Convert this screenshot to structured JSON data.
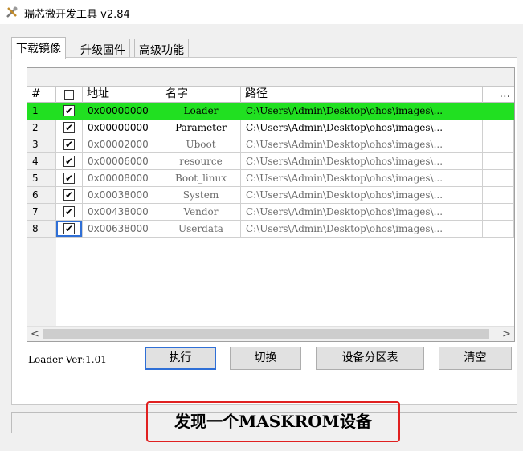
{
  "window": {
    "title": "瑞芯微开发工具 v2.84",
    "icon": "rockchip-tool-icon"
  },
  "tabs": [
    {
      "label": "下载镜像",
      "active": true
    },
    {
      "label": "升级固件",
      "active": false
    },
    {
      "label": "高级功能",
      "active": false
    }
  ],
  "table": {
    "columns": [
      "#",
      "",
      "地址",
      "名字",
      "路径",
      "..."
    ],
    "rows": [
      {
        "num": "1",
        "checked": "✔",
        "address": "0x00000000",
        "name": "Loader",
        "path": "C:\\Users\\Admin\\Desktop\\ohos\\images\\...",
        "selected": true
      },
      {
        "num": "2",
        "checked": "✔",
        "address": "0x00000000",
        "name": "Parameter",
        "path": "C:\\Users\\Admin\\Desktop\\ohos\\images\\...",
        "selected": false
      },
      {
        "num": "3",
        "checked": "✔",
        "address": "0x00002000",
        "name": "Uboot",
        "path": "C:\\Users\\Admin\\Desktop\\ohos\\images\\...",
        "selected": false
      },
      {
        "num": "4",
        "checked": "✔",
        "address": "0x00006000",
        "name": "resource",
        "path": "C:\\Users\\Admin\\Desktop\\ohos\\images\\...",
        "selected": false
      },
      {
        "num": "5",
        "checked": "✔",
        "address": "0x00008000",
        "name": "Boot_linux",
        "path": "C:\\Users\\Admin\\Desktop\\ohos\\images\\...",
        "selected": false
      },
      {
        "num": "6",
        "checked": "✔",
        "address": "0x00038000",
        "name": "System",
        "path": "C:\\Users\\Admin\\Desktop\\ohos\\images\\...",
        "selected": false
      },
      {
        "num": "7",
        "checked": "✔",
        "address": "0x00438000",
        "name": "Vendor",
        "path": "C:\\Users\\Admin\\Desktop\\ohos\\images\\...",
        "selected": false
      },
      {
        "num": "8",
        "checked": "✔",
        "address": "0x00638000",
        "name": "Userdata",
        "path": "C:\\Users\\Admin\\Desktop\\ohos\\images\\...",
        "selected": false
      }
    ],
    "scroll_left": "<",
    "scroll_right": ">"
  },
  "loader_version": "Loader Ver:1.01",
  "buttons": {
    "execute": "执行",
    "switch": "切换",
    "partition_table": "设备分区表",
    "clear": "清空"
  },
  "status": {
    "message": "发现一个MASKROM设备"
  },
  "colors": {
    "selected_row": "#21e021",
    "highlight_box": "#e02020",
    "focus_border": "#2f6fd6"
  }
}
